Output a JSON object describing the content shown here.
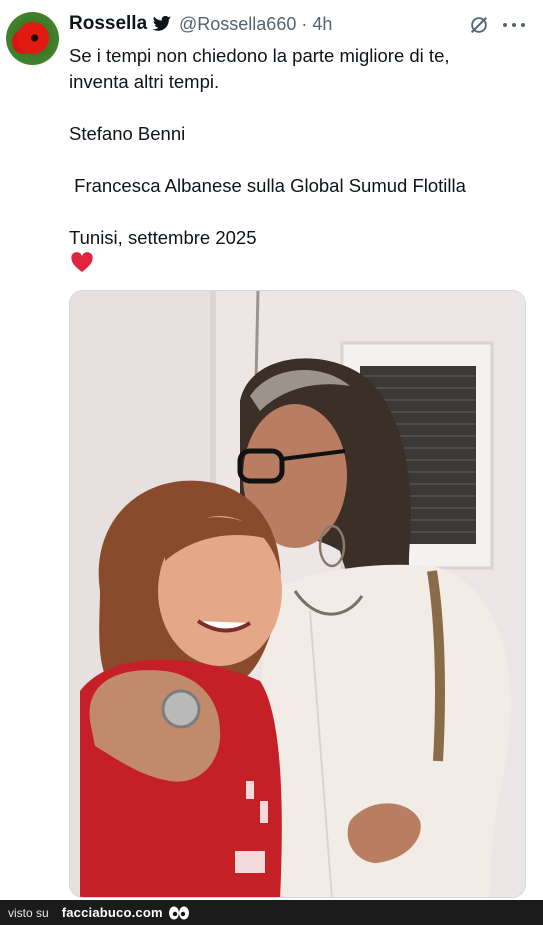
{
  "tweet": {
    "display_name": "Rossella",
    "handle": "@Rossella660",
    "separator": "·",
    "time": "4h",
    "lines": [
      "Se i tempi non chiedono la parte migliore di te,",
      "inventa altri tempi.",
      "",
      "Stefano Benni",
      "",
      " Francesca Albanese sulla Global Sumud Flotilla",
      "",
      "Tunisi, settembre 2025"
    ],
    "heart_emoji": "heart",
    "media_alt": "photo"
  },
  "icons": {
    "verified": "bird-icon",
    "grok": "grok-icon",
    "more": "more-icon",
    "avatar": "poppy-avatar"
  },
  "footer": {
    "visto_label": "visto su",
    "brand": "facciabuco.com"
  },
  "colors": {
    "text": "#0f1419",
    "muted": "#536471",
    "heart": "#e0243d",
    "footer_bg": "#1b1b1b"
  }
}
